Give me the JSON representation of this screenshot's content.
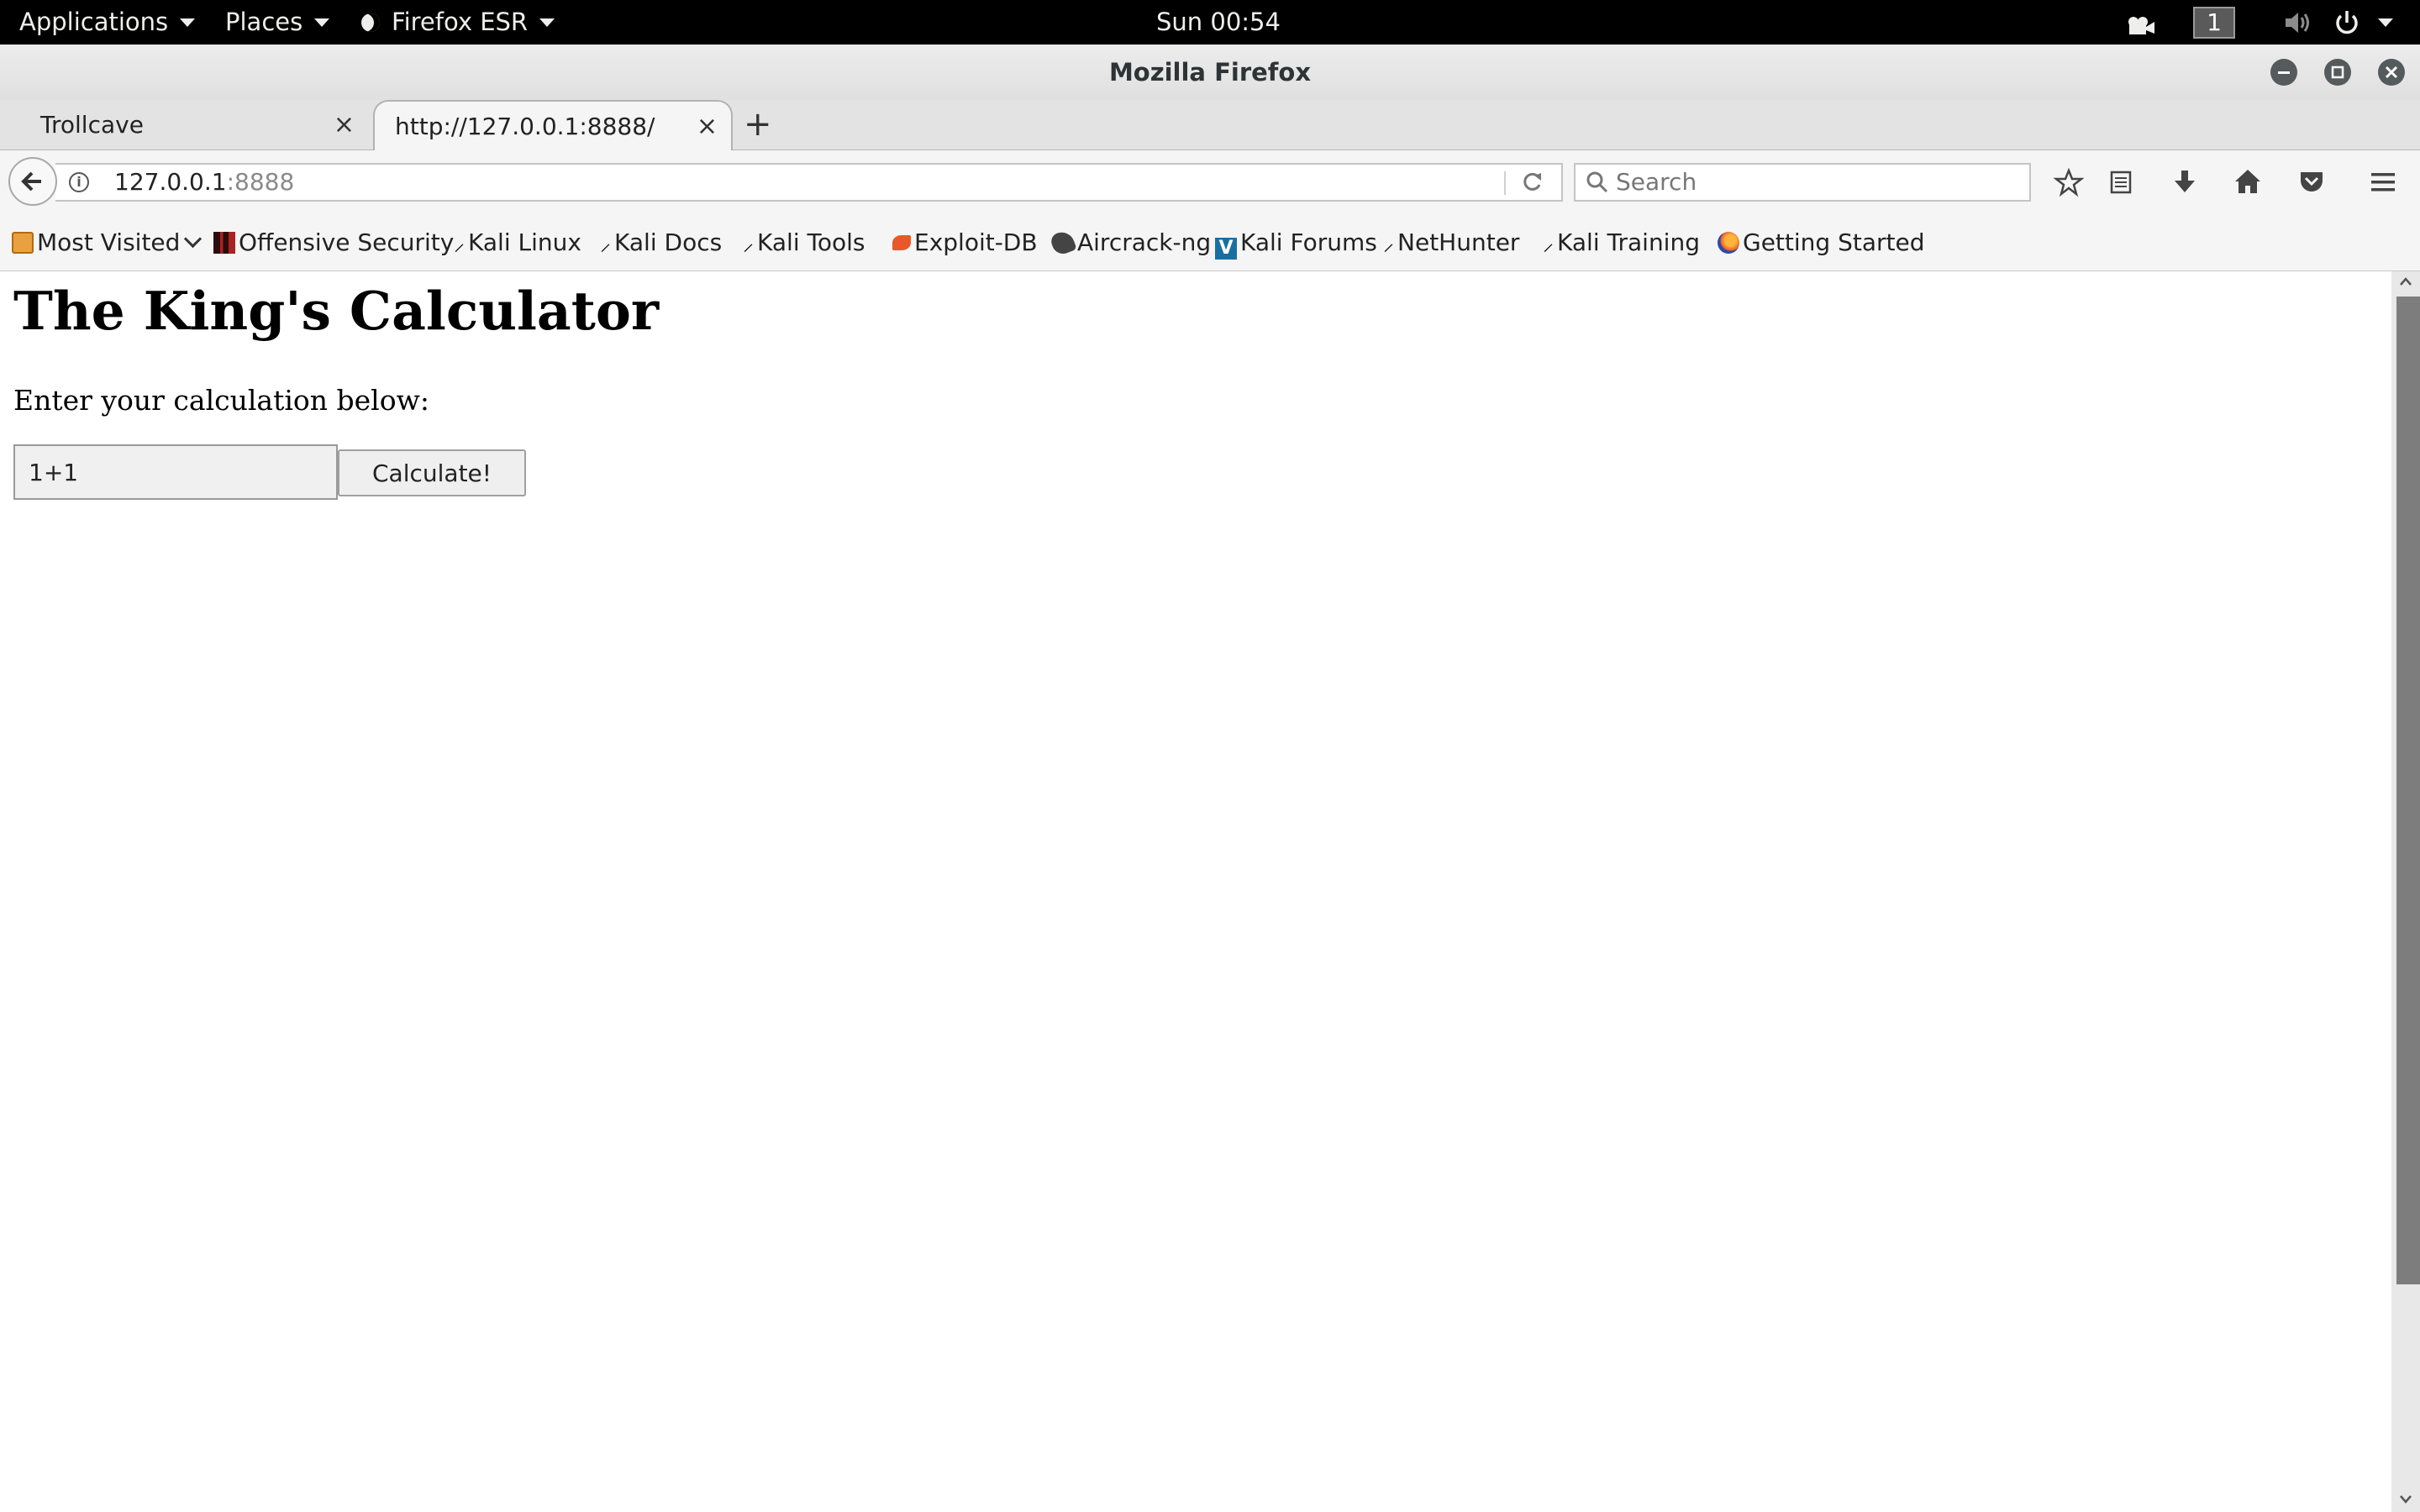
{
  "topbar": {
    "applications": "Applications",
    "places": "Places",
    "firefox_menu": "Firefox ESR",
    "clock": "Sun 00:54",
    "workspace": "1"
  },
  "window": {
    "title": "Mozilla Firefox"
  },
  "tabs": [
    {
      "label": "Trollcave",
      "active": false
    },
    {
      "label": "http://127.0.0.1:8888/",
      "active": true
    }
  ],
  "navbar": {
    "url_host": "127.0.0.1",
    "url_port": ":8888",
    "search_placeholder": "Search"
  },
  "bookmarks": [
    {
      "label": "Most Visited",
      "icon": "folder-icon"
    },
    {
      "label": "Offensive Security",
      "icon": "offsec-icon"
    },
    {
      "label": "Kali Linux",
      "icon": "kali-dragon-icon"
    },
    {
      "label": "Kali Docs",
      "icon": "kali-dragon-icon"
    },
    {
      "label": "Kali Tools",
      "icon": "kali-dragon-icon"
    },
    {
      "label": "Exploit-DB",
      "icon": "exploit-db-icon"
    },
    {
      "label": "Aircrack-ng",
      "icon": "aircrack-icon"
    },
    {
      "label": "Kali Forums",
      "icon": "kali-forums-icon"
    },
    {
      "label": "NetHunter",
      "icon": "kali-dragon-icon"
    },
    {
      "label": "Kali Training",
      "icon": "kali-dragon-icon"
    },
    {
      "label": "Getting Started",
      "icon": "firefox-icon"
    }
  ],
  "page": {
    "heading": "The King's Calculator",
    "prompt": "Enter your calculation below:",
    "input_value": "1+1",
    "button_label": "Calculate!"
  }
}
